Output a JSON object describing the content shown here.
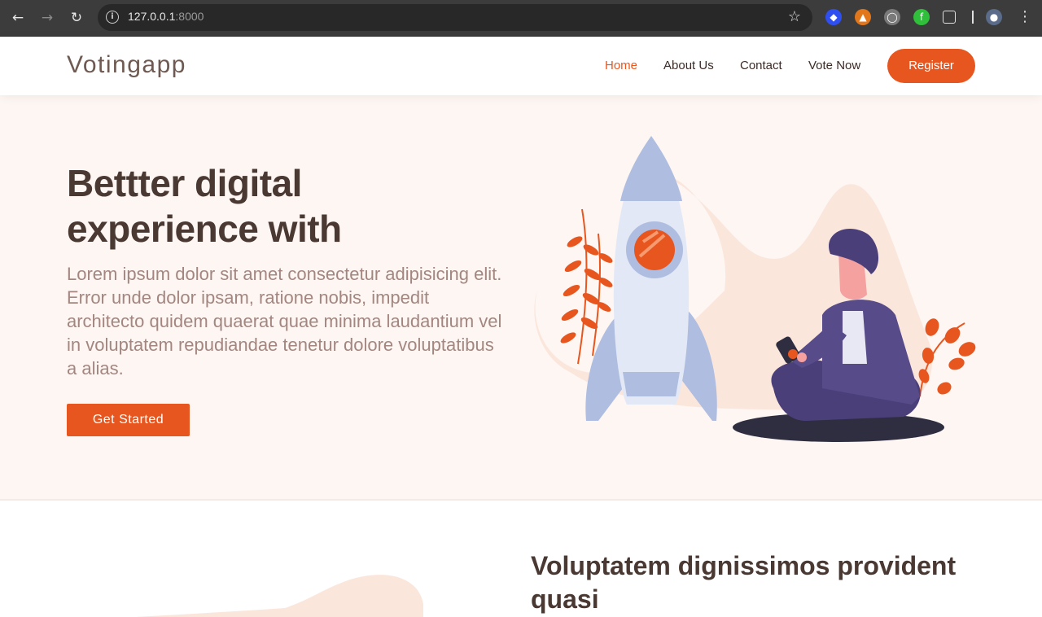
{
  "browser": {
    "url_host": "127.0.0.1",
    "url_port": ":8000"
  },
  "site": {
    "logo": "Votingapp",
    "nav": {
      "home": "Home",
      "about": "About Us",
      "contact": "Contact",
      "vote": "Vote Now",
      "register": "Register"
    }
  },
  "hero": {
    "title": "Bettter digital experience with",
    "text": "Lorem ipsum dolor sit amet consectetur adipisicing elit. Error unde dolor ipsam, ratione nobis, impedit architecto quidem quaerat quae minima laudantium vel in voluptatem repudiandae tenetur dolore voluptatibus a alias.",
    "cta": "Get Started"
  },
  "section2": {
    "title": "Voluptatem dignissimos provident quasi"
  },
  "colors": {
    "accent": "#e8561f",
    "heading": "#4a3833",
    "hero_bg": "#fdf6f2"
  }
}
